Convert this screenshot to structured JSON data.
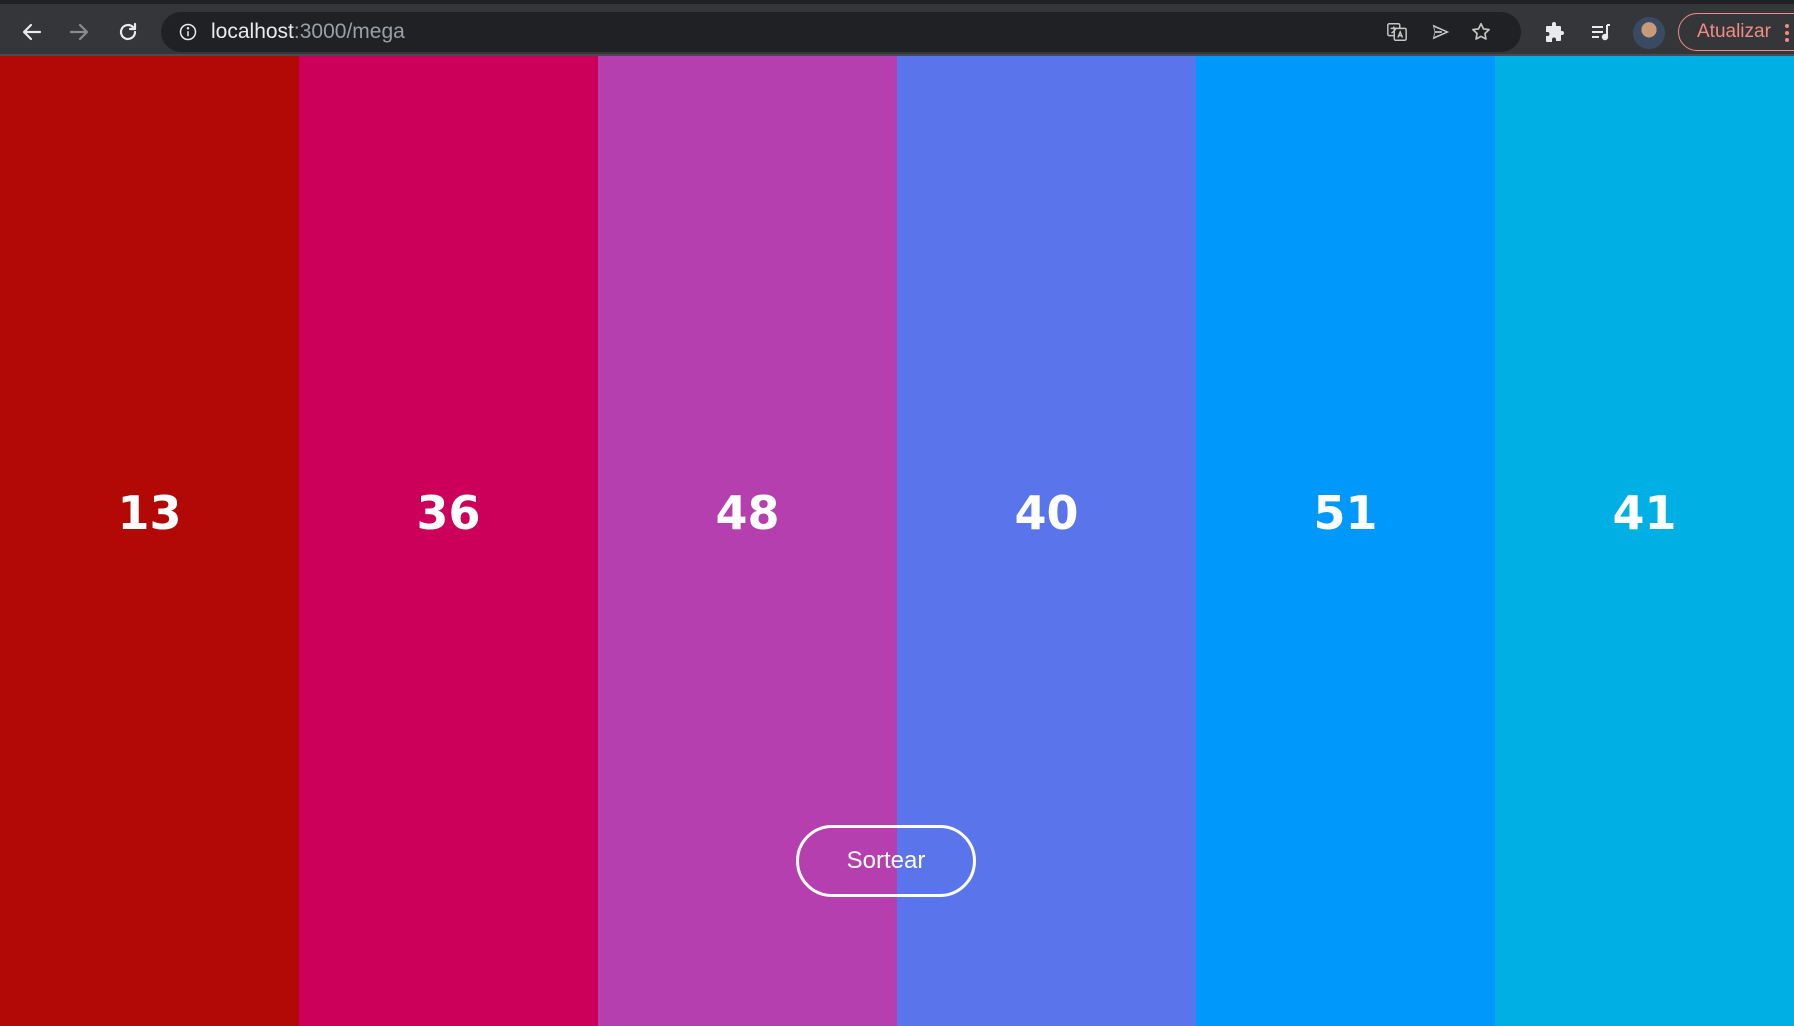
{
  "browser": {
    "url_host": "localhost",
    "url_path": ":3000/mega",
    "update_label": "Atualizar",
    "icons": {
      "back": "back-arrow-icon",
      "forward": "forward-arrow-icon",
      "reload": "reload-icon",
      "info": "info-icon",
      "translate": "translate-icon",
      "send": "send-icon",
      "bookmark": "star-icon",
      "extensions": "puzzle-icon",
      "media": "media-queue-icon",
      "avatar": "avatar",
      "menu": "kebab-menu-icon"
    }
  },
  "page": {
    "numbers": [
      {
        "value": "13",
        "color": "#b30906"
      },
      {
        "value": "36",
        "color": "#cc005a"
      },
      {
        "value": "48",
        "color": "#b63fb0"
      },
      {
        "value": "40",
        "color": "#5a75eb"
      },
      {
        "value": "51",
        "color": "#0099fb"
      },
      {
        "value": "41",
        "color": "#00afe3"
      }
    ],
    "draw_button_label": "Sortear"
  }
}
